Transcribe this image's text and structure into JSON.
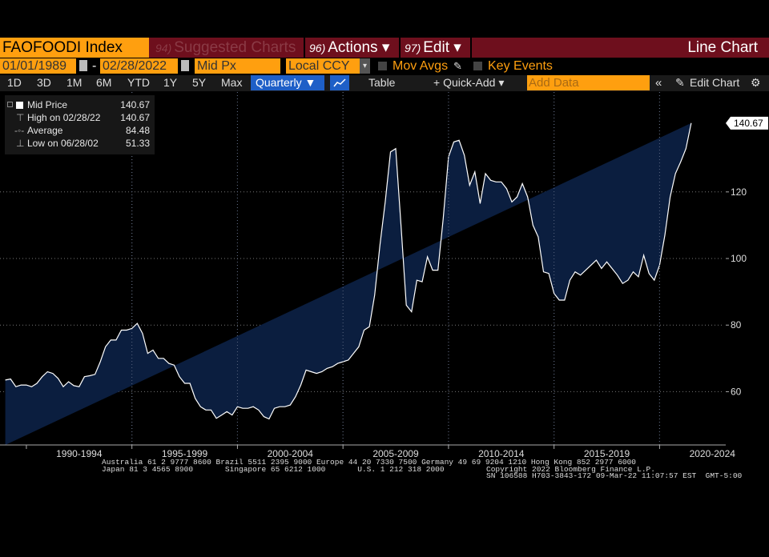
{
  "topbar": {
    "ticker": "FAOFOODI Index",
    "menu": [
      {
        "num": "94)",
        "label": "Suggested Charts",
        "dim": true
      },
      {
        "num": "96)",
        "label": "Actions ▾",
        "dim": false
      },
      {
        "num": "97)",
        "label": "Edit ▾",
        "dim": false
      }
    ],
    "chart_type_label": "Line Chart"
  },
  "row2": {
    "start_date": "01/01/1989",
    "date_sep": "-",
    "end_date": "02/28/2022",
    "field": "Mid Px",
    "currency": "Local CCY",
    "mov_avgs": "Mov Avgs",
    "key_events": "Key Events"
  },
  "row3": {
    "periods": [
      "1D",
      "3D",
      "1M",
      "6M",
      "YTD",
      "1Y",
      "5Y",
      "Max"
    ],
    "frequency": "Quarterly ▼",
    "table": "Table",
    "quick_add": "+ Quick-Add ▾",
    "add_data_placeholder": "Add Data",
    "edit_chart": "Edit Chart"
  },
  "legend": {
    "rows": [
      {
        "label": "Mid Price",
        "value": "140.67"
      },
      {
        "label": "High on 02/28/22",
        "value": "140.67"
      },
      {
        "label": "Average",
        "value": "84.48"
      },
      {
        "label": "Low on 06/28/02",
        "value": "51.33"
      }
    ]
  },
  "last_price_tag": "140.67",
  "footer": {
    "line1": "Australia 61 2 9777 8600 Brazil 5511 2395 9000 Europe 44 20 7330 7500 Germany 49 69 9204 1210 Hong Kong 852 2977 6000",
    "line2a": "Japan 81 3 4565 8900       Singapore 65 6212 1000       U.S. 1 212 318 2000",
    "line2b": "Copyright 2022 Bloomberg Finance L.P.",
    "line3": "SN 106588 H703-3843-172 09-Mar-22 11:07:57 EST  GMT-5:00"
  },
  "colors": {
    "area": "#0b1e3f",
    "line": "#ffffff",
    "accent": "#ff9f0f",
    "topbar": "#6e0f1d"
  },
  "chart_data": {
    "type": "area",
    "x_label_type": "year",
    "yticks": [
      60,
      80,
      100,
      120
    ],
    "ylim": [
      44,
      150
    ],
    "xlim": [
      1988.75,
      2022.3
    ],
    "xticks": [
      "1990-1994",
      "1995-1999",
      "2000-2004",
      "2005-2009",
      "2010-2014",
      "2015-2019",
      "2020-2024"
    ],
    "x": [
      1989.0,
      1989.25,
      1989.5,
      1989.75,
      1990.0,
      1990.25,
      1990.5,
      1990.75,
      1991.0,
      1991.25,
      1991.5,
      1991.75,
      1992.0,
      1992.25,
      1992.5,
      1992.75,
      1993.0,
      1993.25,
      1993.5,
      1993.75,
      1994.0,
      1994.25,
      1994.5,
      1994.75,
      1995.0,
      1995.25,
      1995.5,
      1995.75,
      1996.0,
      1996.25,
      1996.5,
      1996.75,
      1997.0,
      1997.25,
      1997.5,
      1997.75,
      1998.0,
      1998.25,
      1998.5,
      1998.75,
      1999.0,
      1999.25,
      1999.5,
      1999.75,
      2000.0,
      2000.25,
      2000.5,
      2000.75,
      2001.0,
      2001.25,
      2001.5,
      2001.75,
      2002.0,
      2002.25,
      2002.5,
      2002.75,
      2003.0,
      2003.25,
      2003.5,
      2003.75,
      2004.0,
      2004.25,
      2004.5,
      2004.75,
      2005.0,
      2005.25,
      2005.5,
      2005.75,
      2006.0,
      2006.25,
      2006.5,
      2006.75,
      2007.0,
      2007.25,
      2007.5,
      2007.75,
      2008.0,
      2008.25,
      2008.5,
      2008.75,
      2009.0,
      2009.25,
      2009.5,
      2009.75,
      2010.0,
      2010.25,
      2010.5,
      2010.75,
      2011.0,
      2011.25,
      2011.5,
      2011.75,
      2012.0,
      2012.25,
      2012.5,
      2012.75,
      2013.0,
      2013.25,
      2013.5,
      2013.75,
      2014.0,
      2014.25,
      2014.5,
      2014.75,
      2015.0,
      2015.25,
      2015.5,
      2015.75,
      2016.0,
      2016.25,
      2016.5,
      2016.75,
      2017.0,
      2017.25,
      2017.5,
      2017.75,
      2018.0,
      2018.25,
      2018.5,
      2018.75,
      2019.0,
      2019.25,
      2019.5,
      2019.75,
      2020.0,
      2020.25,
      2020.5,
      2020.75,
      2021.0,
      2021.25,
      2021.5,
      2021.75,
      2022.0,
      2022.17
    ],
    "values": [
      63.5,
      63.8,
      61.5,
      62.0,
      62.0,
      61.5,
      62.5,
      64.5,
      66.0,
      65.5,
      64.0,
      61.5,
      63.0,
      61.8,
      61.5,
      64.5,
      64.8,
      65.2,
      69.0,
      73.5,
      75.5,
      75.5,
      78.5,
      78.5,
      79.0,
      80.5,
      77.5,
      71.5,
      72.5,
      70.0,
      70.0,
      68.5,
      68.0,
      64.5,
      62.5,
      62.5,
      58.0,
      55.5,
      54.5,
      54.5,
      52.0,
      53.0,
      54.0,
      53.0,
      55.5,
      55.0,
      55.0,
      55.5,
      54.5,
      52.5,
      51.8,
      55.0,
      55.5,
      55.5,
      56.0,
      58.5,
      62.0,
      66.5,
      66.0,
      65.5,
      66.0,
      67.0,
      67.5,
      68.5,
      69.0,
      69.5,
      71.5,
      73.5,
      78.5,
      79.5,
      89.0,
      104.0,
      117.0,
      132.0,
      133.0,
      110.0,
      86.0,
      84.0,
      93.5,
      93.0,
      100.5,
      96.5,
      96.5,
      112.0,
      130.5,
      135.0,
      135.5,
      131.0,
      122.0,
      126.0,
      116.5,
      125.5,
      123.5,
      123.0,
      123.0,
      121.0,
      117.0,
      118.5,
      122.5,
      118.5,
      110.0,
      106.5,
      96.0,
      95.5,
      89.5,
      87.5,
      87.5,
      93.5,
      96.0,
      95.0,
      96.5,
      98.0,
      99.5,
      97.0,
      99.0,
      97.0,
      95.0,
      92.5,
      93.5,
      96.0,
      94.5,
      101.0,
      95.5,
      93.5,
      98.0,
      107.0,
      118.5,
      125.5,
      129.0,
      133.0,
      140.67
    ]
  }
}
